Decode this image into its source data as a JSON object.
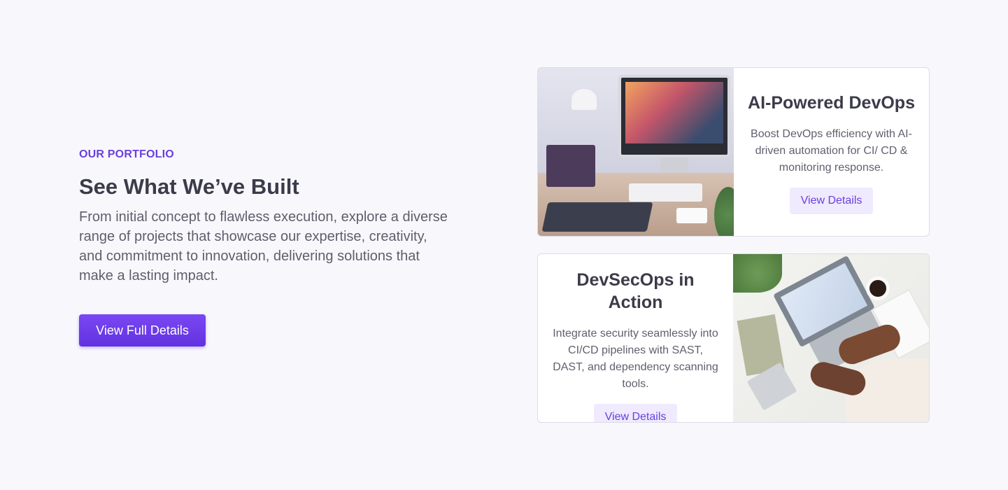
{
  "section": {
    "eyebrow": "OUR PORTFOLIO",
    "headline": "See What We’ve Built",
    "description": "From initial concept to flawless execution, explore a diverse range of projects that showcase our expertise, creativity, and commitment to innovation, delivering solutions that make a lasting impact.",
    "cta_label": "View Full Details"
  },
  "cards": [
    {
      "title": "AI-Powered DevOps",
      "text": "Boost DevOps efficiency with AI-driven automation for CI/ CD & monitoring response.",
      "button_label": "View Details",
      "image_icon": "desk-computer-photo"
    },
    {
      "title": "DevSecOps in Action",
      "text": "Integrate security seamlessly into CI/CD pipelines with SAST, DAST, and dependency scanning tools.",
      "button_label": "View Details",
      "image_icon": "laptop-workspace-photo"
    }
  ],
  "colors": {
    "accent": "#6b3fe0",
    "background": "#f8f8fc",
    "button_soft": "#efeafd"
  }
}
